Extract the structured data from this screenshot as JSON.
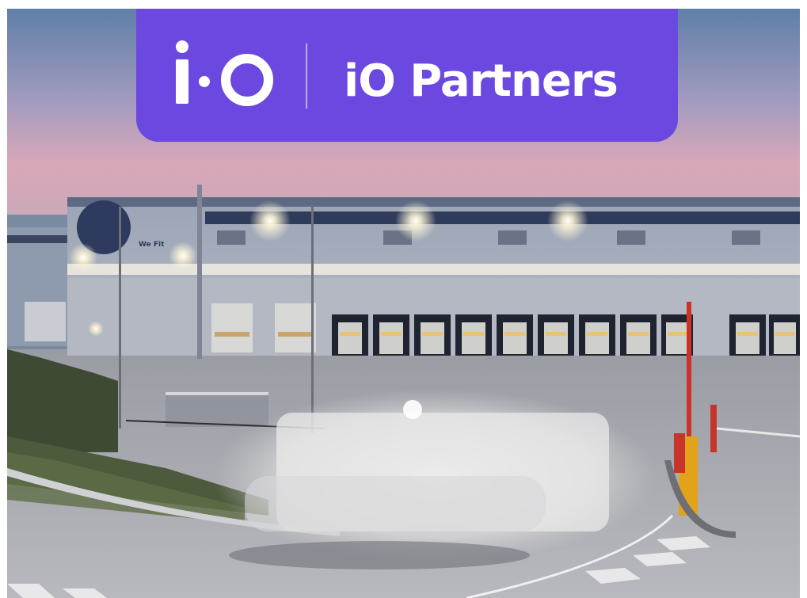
{
  "brand": {
    "logo_text": "i·O",
    "name": "iO Partners",
    "accent_color": "#6b49e0"
  },
  "photo": {
    "building_sign_text": "We Fit",
    "icons": [
      "io-logo-icon"
    ]
  }
}
